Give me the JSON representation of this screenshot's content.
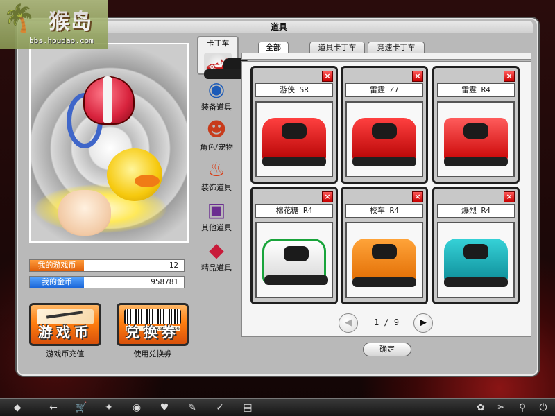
{
  "logo": {
    "brand": "猴岛",
    "url": "bbs.houdao.com"
  },
  "window": {
    "title": "道具"
  },
  "currency": {
    "game_coin_label": "我的游戏币",
    "game_coin_value": "12",
    "gold_label": "我的金币",
    "gold_value": "958781"
  },
  "buttons": {
    "recharge_text": "游戏币",
    "recharge_caption": "游戏币充值",
    "voucher_text": "兑换券",
    "voucher_code": "B  0K6B74266",
    "voucher_caption": "使用兑换券"
  },
  "categories": [
    {
      "label": "卡丁车",
      "icon": "kart-icon"
    },
    {
      "label": "装备道具",
      "icon": "goggles-icon"
    },
    {
      "label": "角色/宠物",
      "icon": "monkey-icon"
    },
    {
      "label": "装饰道具",
      "icon": "flame-shirt-icon"
    },
    {
      "label": "其他道具",
      "icon": "gift-box-icon"
    },
    {
      "label": "精品道具",
      "icon": "gem-icon"
    }
  ],
  "tabs": [
    "全部",
    "道具卡丁车",
    "竞速卡丁车"
  ],
  "items": [
    {
      "name": "游侠 SR",
      "delete": "×"
    },
    {
      "name": "雷霆 Z7",
      "delete": "×"
    },
    {
      "name": "雷霆 R4",
      "delete": "×"
    },
    {
      "name": "棉花糖 R4",
      "delete": "×"
    },
    {
      "name": "校车 R4",
      "delete": "×"
    },
    {
      "name": "爆烈 R4",
      "delete": "×"
    }
  ],
  "pager": {
    "text": "1 / 9",
    "prev": "◀",
    "next": "▶"
  },
  "confirm_label": "确定",
  "taskbar": [
    "◆",
    "←",
    "🛒",
    "✦",
    "◉",
    "♥",
    "✎",
    "✓",
    "▤",
    "✿",
    "✂",
    "⚲",
    "⏻"
  ]
}
